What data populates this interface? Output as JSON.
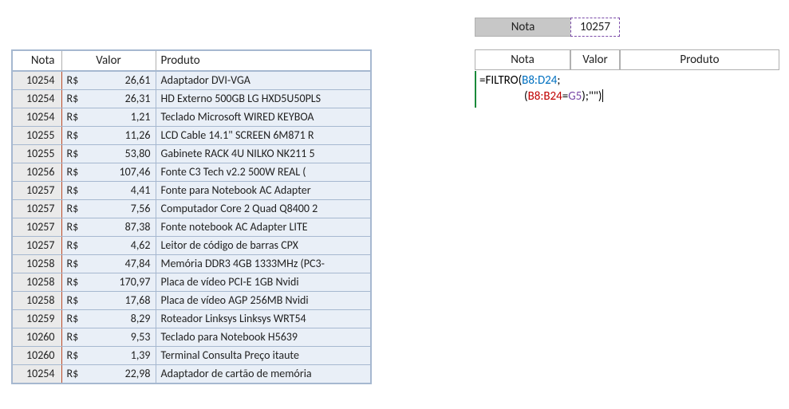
{
  "left_headers": {
    "nota": "Nota",
    "valor": "Valor",
    "produto": "Produto"
  },
  "currency": "R$",
  "rows": [
    {
      "nota": "10254",
      "valor": "26,61",
      "produto": "Adaptador DVI-VGA"
    },
    {
      "nota": "10254",
      "valor": "26,31",
      "produto": "HD Externo 500GB LG HXD5U50PLS"
    },
    {
      "nota": "10254",
      "valor": "1,21",
      "produto": "Teclado Microsoft WIRED KEYBOA"
    },
    {
      "nota": "10255",
      "valor": "11,26",
      "produto": "LCD Cable 14.1\" SCREEN 6M871 R"
    },
    {
      "nota": "10255",
      "valor": "53,80",
      "produto": "Gabinete RACK 4U NILKO NK211 5"
    },
    {
      "nota": "10256",
      "valor": "107,46",
      "produto": "Fonte C3 Tech v2.2 500W REAL ("
    },
    {
      "nota": "10257",
      "valor": "4,41",
      "produto": "Fonte para Notebook AC Adapter"
    },
    {
      "nota": "10257",
      "valor": "7,56",
      "produto": "Computador Core 2 Quad Q8400 2"
    },
    {
      "nota": "10257",
      "valor": "87,38",
      "produto": "Fonte notebook AC Adapter LITE"
    },
    {
      "nota": "10257",
      "valor": "4,62",
      "produto": "Leitor de código de barras CPX"
    },
    {
      "nota": "10258",
      "valor": "47,84",
      "produto": "Memória DDR3 4GB 1333MHz (PC3-"
    },
    {
      "nota": "10258",
      "valor": "170,97",
      "produto": "Placa de vídeo PCI-E 1GB Nvidi"
    },
    {
      "nota": "10258",
      "valor": "17,68",
      "produto": "Placa de vídeo AGP 256MB Nvidi"
    },
    {
      "nota": "10259",
      "valor": "8,29",
      "produto": "Roteador Linksys Linksys WRT54"
    },
    {
      "nota": "10260",
      "valor": "9,53",
      "produto": "Teclado para Notebook H5639"
    },
    {
      "nota": "10260",
      "valor": "1,39",
      "produto": "Terminal Consulta Preço itaute"
    },
    {
      "nota": "10254",
      "valor": "22,98",
      "produto": "Adaptador de cartão de memória"
    }
  ],
  "lookup": {
    "label": "Nota",
    "value": "10257"
  },
  "right_headers": {
    "nota": "Nota",
    "valor": "Valor",
    "produto": "Produto"
  },
  "formula": {
    "eq": "=",
    "func": "FILTRO",
    "open": "(",
    "range1": "B8:D24",
    "sep1": ";",
    "open2": "(",
    "range2": "B8:B24",
    "eq2": "=",
    "cell": "G5",
    "close2_sep": ");",
    "empty": "\"\"",
    "close": ")"
  }
}
